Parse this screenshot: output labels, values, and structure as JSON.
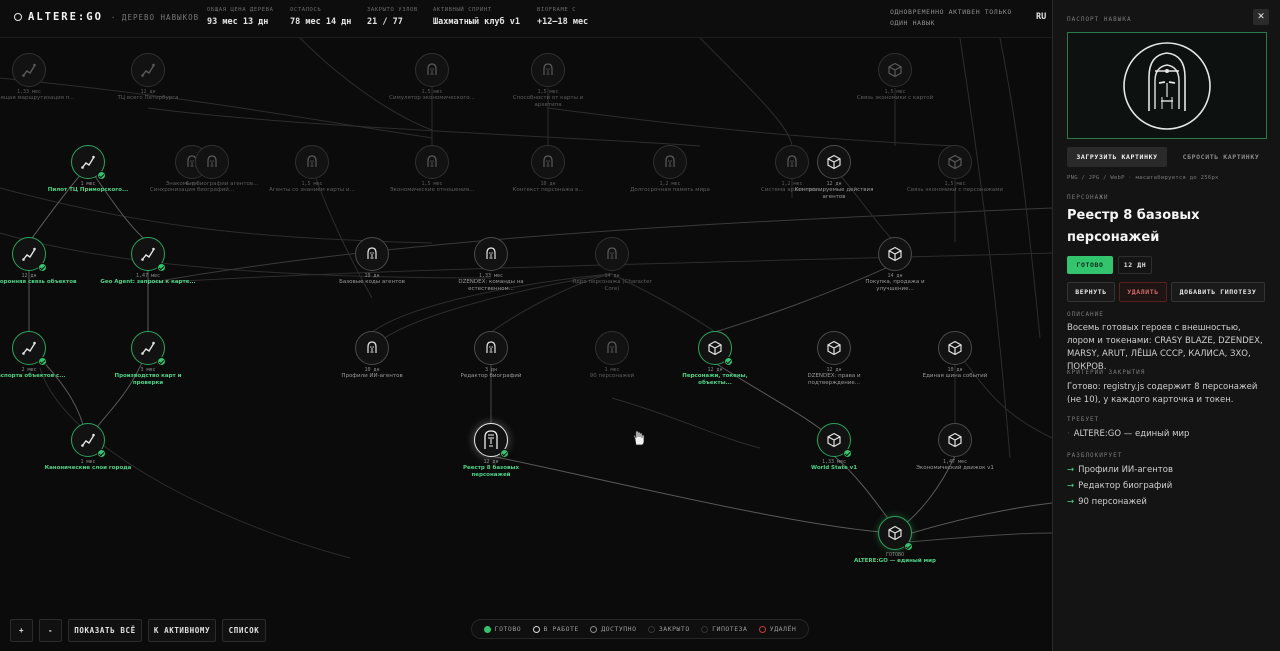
{
  "app": {
    "title": "ALTERE:GO",
    "subtitle": "· ДЕРЕВО НАВЫКОВ",
    "lang": "RU"
  },
  "stats": [
    {
      "label": "ОБЩАЯ ЦЕНА ДЕРЕВА",
      "value": "93 мес 13 дн"
    },
    {
      "label": "ОСТАЛОСЬ",
      "value": "78 мес 14 дн"
    },
    {
      "label": "ЗАКРЫТО УЗЛОВ",
      "value": "21 / 77"
    },
    {
      "label": "АКТИВНЫЙ СПРИНТ",
      "value": "Шахматный клуб v1"
    },
    {
      "label": "BIOFRAME C",
      "value": "+12–18 мес"
    }
  ],
  "top_note": "ОДНОВРЕМЕННО АКТИВЕН ТОЛЬКО ОДИН НАВЫК",
  "nodes": [
    {
      "id": "n1",
      "dur": "1,33 мес",
      "label": "Настоящая маршрутизация п...",
      "icon": "route",
      "state": "dim"
    },
    {
      "id": "n2",
      "dur": "12 дн",
      "label": "ТЦ всего Петербурга",
      "icon": "route",
      "state": "dim"
    },
    {
      "id": "n3",
      "dur": "1,5 мес",
      "label": "Симулятор экономического...",
      "icon": "face",
      "state": "dim"
    },
    {
      "id": "n4",
      "dur": "1,5 мес",
      "label": "Способности от карты и архетипа",
      "icon": "face",
      "state": "dim"
    },
    {
      "id": "n5",
      "dur": "1,5 мес",
      "label": "Связь экономики с картой",
      "icon": "cube",
      "state": "dim"
    },
    {
      "id": "n6",
      "dur": "1 мес",
      "label": "Пилот ТЦ Приморского...",
      "icon": "route",
      "state": "done"
    },
    {
      "id": "n7",
      "dur": "6 дн",
      "label": "Синхронизация биографий...",
      "icon": "face",
      "state": "dim"
    },
    {
      "id": "n8",
      "dur": "",
      "label": "Знакомые биографии агентов...",
      "icon": "face",
      "state": "dim"
    },
    {
      "id": "n9",
      "dur": "1,5 мес",
      "label": "Агенты со знанием карты и...",
      "icon": "face",
      "state": "dim"
    },
    {
      "id": "n10",
      "dur": "1,5 мес",
      "label": "Экономические отношения...",
      "icon": "face",
      "state": "dim"
    },
    {
      "id": "n11",
      "dur": "10 дн",
      "label": "Контекст персонажа в...",
      "icon": "face",
      "state": "dim"
    },
    {
      "id": "n12",
      "dur": "1,2 мес",
      "label": "Долгосрочная память мира",
      "icon": "face",
      "state": "dim"
    },
    {
      "id": "n13",
      "dur": "1,2 мес",
      "label": "Система архетипов...",
      "icon": "face",
      "state": "dim"
    },
    {
      "id": "n14",
      "dur": "12 дн",
      "label": "Контролируемые действия агентов",
      "icon": "cube",
      "state": "normal"
    },
    {
      "id": "n15",
      "dur": "1,5 мес",
      "label": "Связь экономики с персонажами",
      "icon": "cube",
      "state": "dim"
    },
    {
      "id": "n16",
      "dur": "12 дн",
      "label": "Двусторонняя связь объектов",
      "icon": "route",
      "state": "done"
    },
    {
      "id": "n17",
      "dur": "1,47 мес",
      "label": "Geo Agent: запросы к карте...",
      "icon": "route",
      "state": "done"
    },
    {
      "id": "n18",
      "dur": "10 дн",
      "label": "Базовые коды агентов",
      "icon": "face",
      "state": "normal"
    },
    {
      "id": "n19",
      "dur": "1,33 мес",
      "label": "DZENDEX: команды на естественном...",
      "icon": "face",
      "state": "normal"
    },
    {
      "id": "n20",
      "dur": "14 дн",
      "label": "Ядро персонажа (Character Core)",
      "icon": "face",
      "state": "dim"
    },
    {
      "id": "n21",
      "dur": "14 дн",
      "label": "Покупка, продажа и улучшение...",
      "icon": "cube",
      "state": "normal"
    },
    {
      "id": "n22",
      "dur": "2 мес",
      "label": "Паспорта объектов с...",
      "icon": "route",
      "state": "done"
    },
    {
      "id": "n23",
      "dur": "3 мес",
      "label": "Производство карт и проверки",
      "icon": "route",
      "state": "done"
    },
    {
      "id": "n24",
      "dur": "10 дн",
      "label": "Профили ИИ-агентов",
      "icon": "face",
      "state": "normal"
    },
    {
      "id": "n25",
      "dur": "3 дн",
      "label": "Редактор биографий",
      "icon": "face",
      "state": "normal"
    },
    {
      "id": "n26",
      "dur": "1 мес",
      "label": "90 персонажей",
      "icon": "face",
      "state": "dim"
    },
    {
      "id": "n27",
      "dur": "12 дн",
      "label": "Персонажи, токены, объекты...",
      "icon": "cube",
      "state": "done"
    },
    {
      "id": "n28",
      "dur": "12 дн",
      "label": "DZENDEX: права и подтверждение...",
      "icon": "cube",
      "state": "normal"
    },
    {
      "id": "n29",
      "dur": "10 дн",
      "label": "Единая шина событий",
      "icon": "cube",
      "state": "normal"
    },
    {
      "id": "n30",
      "dur": "1 мес",
      "label": "Канонические слои города",
      "icon": "route",
      "state": "done"
    },
    {
      "id": "n31",
      "dur": "12 дн",
      "label": "Реестр 8 базовых персонажей",
      "icon": "portrait",
      "state": "selected"
    },
    {
      "id": "n32",
      "dur": "1,33 мес",
      "label": "World State v1",
      "icon": "cube",
      "state": "done"
    },
    {
      "id": "n33",
      "dur": "1,47 мес",
      "label": "Экономический движок v1",
      "icon": "cube",
      "state": "normal"
    },
    {
      "id": "n34",
      "dur": "ГОТОВО",
      "label": "ALTERE:GO — единый мир",
      "icon": "cube",
      "state": "active"
    }
  ],
  "controls": {
    "zoom_in": "+",
    "zoom_out": "-",
    "show_all": "ПОКАЗАТЬ ВСЁ",
    "to_active": "К АКТИВНОМУ",
    "list": "СПИСОК"
  },
  "legend": [
    {
      "label": "ГОТОВО",
      "color": "#35c26e"
    },
    {
      "label": "В РАБОТЕ",
      "color": "#d8d8d8"
    },
    {
      "label": "ДОСТУПНО",
      "color": "#8a8a8a"
    },
    {
      "label": "ЗАКРЫТО",
      "color": "#333333"
    },
    {
      "label": "ГИПОТЕЗА",
      "color": "#333333"
    },
    {
      "label": "УДАЛЁН",
      "color": "#c23b3b"
    }
  ],
  "panel": {
    "header": "ПАСПОРТ НАВЫКА",
    "close": "✕",
    "upload_btn": "ЗАГРУЗИТЬ КАРТИНКУ",
    "reset_btn": "СБРОСИТЬ КАРТИНКУ",
    "format_hint": "PNG / JPG / WebP · масштабируется до 256px",
    "type_label": "ПЕРСОНАЖИ",
    "title": "Реестр 8 базовых персонажей",
    "status_badge": "ГОТОВО",
    "duration_badge": "12 ДН",
    "return_btn": "ВЕРНУТЬ",
    "delete_btn": "УДАЛИТЬ",
    "hypothesis_btn": "ДОБАВИТЬ ГИПОТЕЗУ",
    "desc_label": "ОПИСАНИЕ",
    "desc": "Восемь готовых героев с внешностью, лором и токенами: CRASY BLAZE, DZENDEX, MARSY, ARUT, ЛЁША СССР, КАЛИСА, ЗХО, ПОКРОВ.",
    "criteria_label": "КРИТЕРИЙ ЗАКРЫТИЯ",
    "criteria": "Готово: registry.js содержит 8 персонажей (не 10), у каждого карточка и токен.",
    "requires_label": "ТРЕБУЕТ",
    "requires": "ALTERE:GO — единый мир",
    "unlocks_label": "РАЗБЛОКИРУЕТ",
    "unlocks": [
      "Профили ИИ-агентов",
      "Редактор биографий",
      "90 персонажей"
    ]
  }
}
